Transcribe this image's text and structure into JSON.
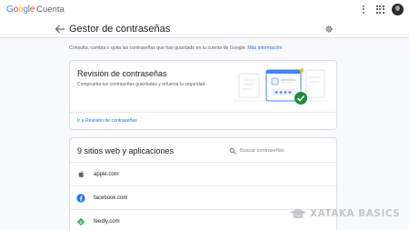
{
  "topbar": {
    "logo_letters": [
      "G",
      "o",
      "o",
      "g",
      "l",
      "e"
    ],
    "logo_colors": [
      "#4285f4",
      "#ea4335",
      "#fbbc05",
      "#4285f4",
      "#34a853",
      "#ea4335"
    ],
    "product_name": "Cuenta",
    "icons": [
      "more-vert-icon",
      "apps-grid-icon",
      "avatar"
    ]
  },
  "header": {
    "title": "Gestor de contraseñas",
    "icons": [
      "back-arrow-icon",
      "gear-icon"
    ]
  },
  "intro": {
    "text": "Consulta, cambia o quita las contraseñas que has guardado en tu cuenta de Google.",
    "link": "Más información"
  },
  "review": {
    "title": "Revisión de contraseñas",
    "description": "Comprueba tus contraseñas guardadas y refuerza tu seguridad.",
    "link": "Ir a Revisión de contraseñas"
  },
  "sites": {
    "title": "9 sitios web y aplicaciones",
    "search_placeholder": "Buscar contraseñas",
    "items": [
      {
        "name": "apple.com",
        "icon": "apple-icon"
      },
      {
        "name": "facebook.com",
        "icon": "facebook-icon"
      },
      {
        "name": "feedly.com",
        "icon": "feedly-icon"
      }
    ]
  },
  "watermark": {
    "text": "XATAKA BASICS"
  },
  "colors": {
    "accent": "#1a73e8",
    "page_bg": "#f8f9fa",
    "facebook": "#1877f2",
    "feedly": "#2bb24c",
    "check_green": "#1e8e3e"
  }
}
